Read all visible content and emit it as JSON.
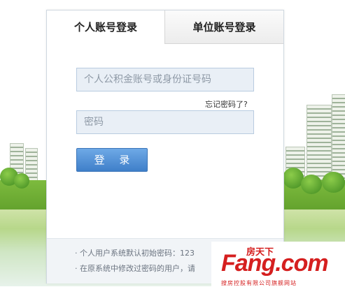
{
  "tabs": {
    "personal": "个人账号登录",
    "organization": "单位账号登录"
  },
  "form": {
    "account_placeholder": "个人公积金账号或身份证号码",
    "password_placeholder": "密码",
    "forgot_password": "忘记密码了?",
    "login_button": "登 录"
  },
  "notice": {
    "line1": "· 个人用户系统默认初始密码：123",
    "line2": "· 在原系统中修改过密码的用户，请"
  },
  "watermark": {
    "top": "房天下",
    "main": "Fang.com",
    "sub": "搜房控股有限公司旗舰网站"
  },
  "colors": {
    "button": "#4a89d2",
    "input_bg": "#e9eff6",
    "brand_red": "#d51f1f"
  }
}
